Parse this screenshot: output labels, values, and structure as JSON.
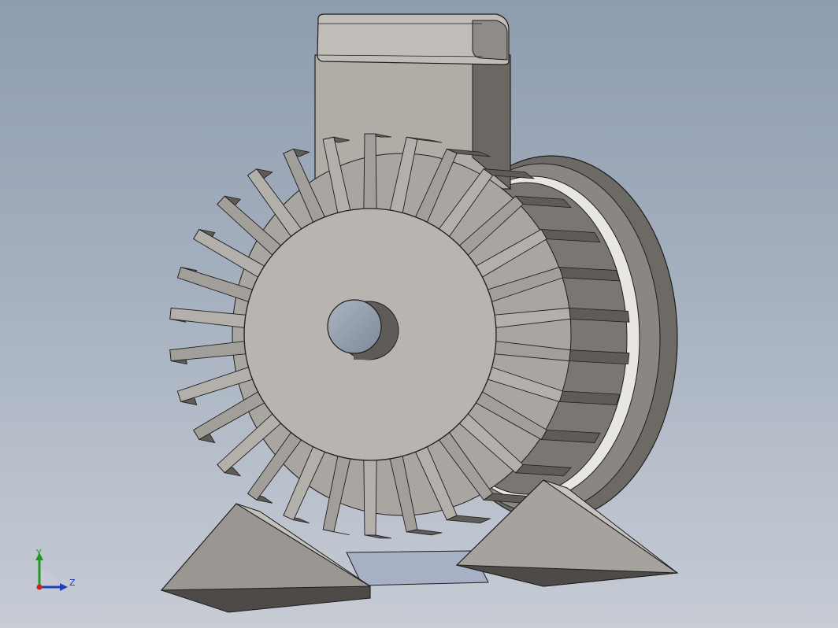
{
  "viewport": {
    "background_top": "#8e9cae",
    "background_bottom": "#c7ccd5"
  },
  "model": {
    "fin_count": 30,
    "colors": {
      "body": "#a9a5a0",
      "face": "#b8b4af",
      "fin_light": "#b3afaa",
      "fin_dark": "#5f5b57",
      "shadow": "#4d4a47",
      "shaft": "#9ca7b6",
      "edge": "#1e1e1e"
    }
  },
  "triad": {
    "y_label": "Y",
    "z_label": "Z",
    "y_color": "#1e9b1e",
    "z_color": "#1f3fbf",
    "origin_color": "#d21e1e"
  }
}
